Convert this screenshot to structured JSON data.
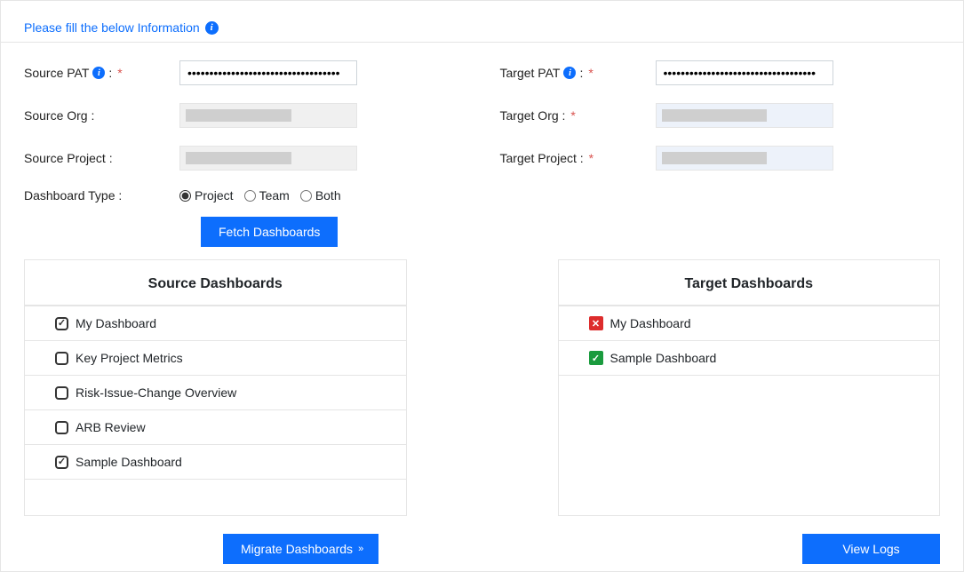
{
  "header": {
    "title": "Please fill the below Information"
  },
  "labels": {
    "source_pat": "Source PAT",
    "source_org": "Source Org :",
    "source_project": "Source Project :",
    "target_pat": "Target PAT",
    "target_org": "Target Org :",
    "target_project": "Target Project :",
    "dashboard_type": "Dashboard Type :",
    "colon_req": " :"
  },
  "values": {
    "source_pat_mask": "•••••••••••••••••••••••••••••••••••",
    "target_pat_mask": "•••••••••••••••••••••••••••••••••••"
  },
  "dashboard_type": {
    "options": [
      "Project",
      "Team",
      "Both"
    ],
    "selected": "Project"
  },
  "buttons": {
    "fetch": "Fetch Dashboards",
    "migrate": "Migrate Dashboards",
    "view_logs": "View Logs"
  },
  "panels": {
    "source_title": "Source Dashboards",
    "target_title": "Target Dashboards"
  },
  "source_dashboards": [
    {
      "name": "My Dashboard",
      "checked": true
    },
    {
      "name": "Key Project Metrics",
      "checked": false
    },
    {
      "name": "Risk-Issue-Change Overview",
      "checked": false
    },
    {
      "name": "ARB Review",
      "checked": false
    },
    {
      "name": "Sample Dashboard",
      "checked": true
    }
  ],
  "target_dashboards": [
    {
      "name": "My Dashboard",
      "status": "fail"
    },
    {
      "name": "Sample Dashboard",
      "status": "ok"
    }
  ]
}
